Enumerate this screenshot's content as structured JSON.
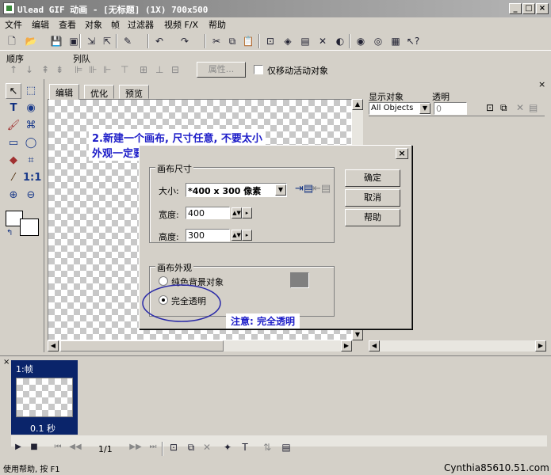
{
  "window": {
    "title": "Ulead GIF 动画 - [无标题] (1X) 700x500",
    "min_glyph": "_",
    "max_glyph": "□",
    "close_glyph": "×"
  },
  "menu": [
    "文件",
    "编辑",
    "查看",
    "对象",
    "帧",
    "过滤器",
    "视频 F/X",
    "帮助"
  ],
  "toolbar": {
    "icons": [
      "new-icon",
      "open-icon",
      "save-icon",
      "save-as-icon",
      "import-icon",
      "export-icon",
      "wizard-icon",
      "undo-icon",
      "redo-icon",
      "cut-icon",
      "copy-icon",
      "paste-icon",
      "crop-icon",
      "optimize-icon",
      "frame-icon",
      "tools-icon",
      "preview-icon",
      "web-icon",
      "browser-icon",
      "help-icon"
    ]
  },
  "object_toolbar": {
    "order_label": "顺序",
    "align_label": "列队",
    "properties_button": "属性...",
    "move_active_label": "仅移动活动对象"
  },
  "tabs": [
    "编辑",
    "优化",
    "预览"
  ],
  "object_panel": {
    "show_label": "显示对象",
    "transparency_label": "透明",
    "select_value": "All Objects",
    "transparency_value": "0"
  },
  "annotations": {
    "top_line1": "2.新建一个画布, 尺寸任意, 不要太小",
    "top_line2": "外观一定要“ 完全透明 ”。",
    "bottom": "注意: 完全透明"
  },
  "dialog": {
    "close_glyph": "×",
    "size_group": "画布尺寸",
    "size_label": "大小:",
    "size_value": "*400 x 300 像素",
    "width_label": "宽度:",
    "width_value": "400",
    "height_label": "高度:",
    "height_value": "300",
    "appearance_group": "画布外观",
    "solid_bg_label": "纯色背景对象",
    "transparent_label": "完全透明",
    "selected_appearance": "完全透明",
    "ok_button": "确定",
    "cancel_button": "取消",
    "help_button": "帮助",
    "solid_color": "#808080"
  },
  "frames": {
    "frame_label": "1:帧",
    "frame_delay": "0.1 秒",
    "page_indicator": "1/1"
  },
  "status": {
    "help_text": "使用帮助, 按 F1",
    "watermark": "Cynthia85610.51.com"
  },
  "colors": {
    "annotation": "#1c1cc8",
    "frame_highlight": "#0a246a"
  }
}
